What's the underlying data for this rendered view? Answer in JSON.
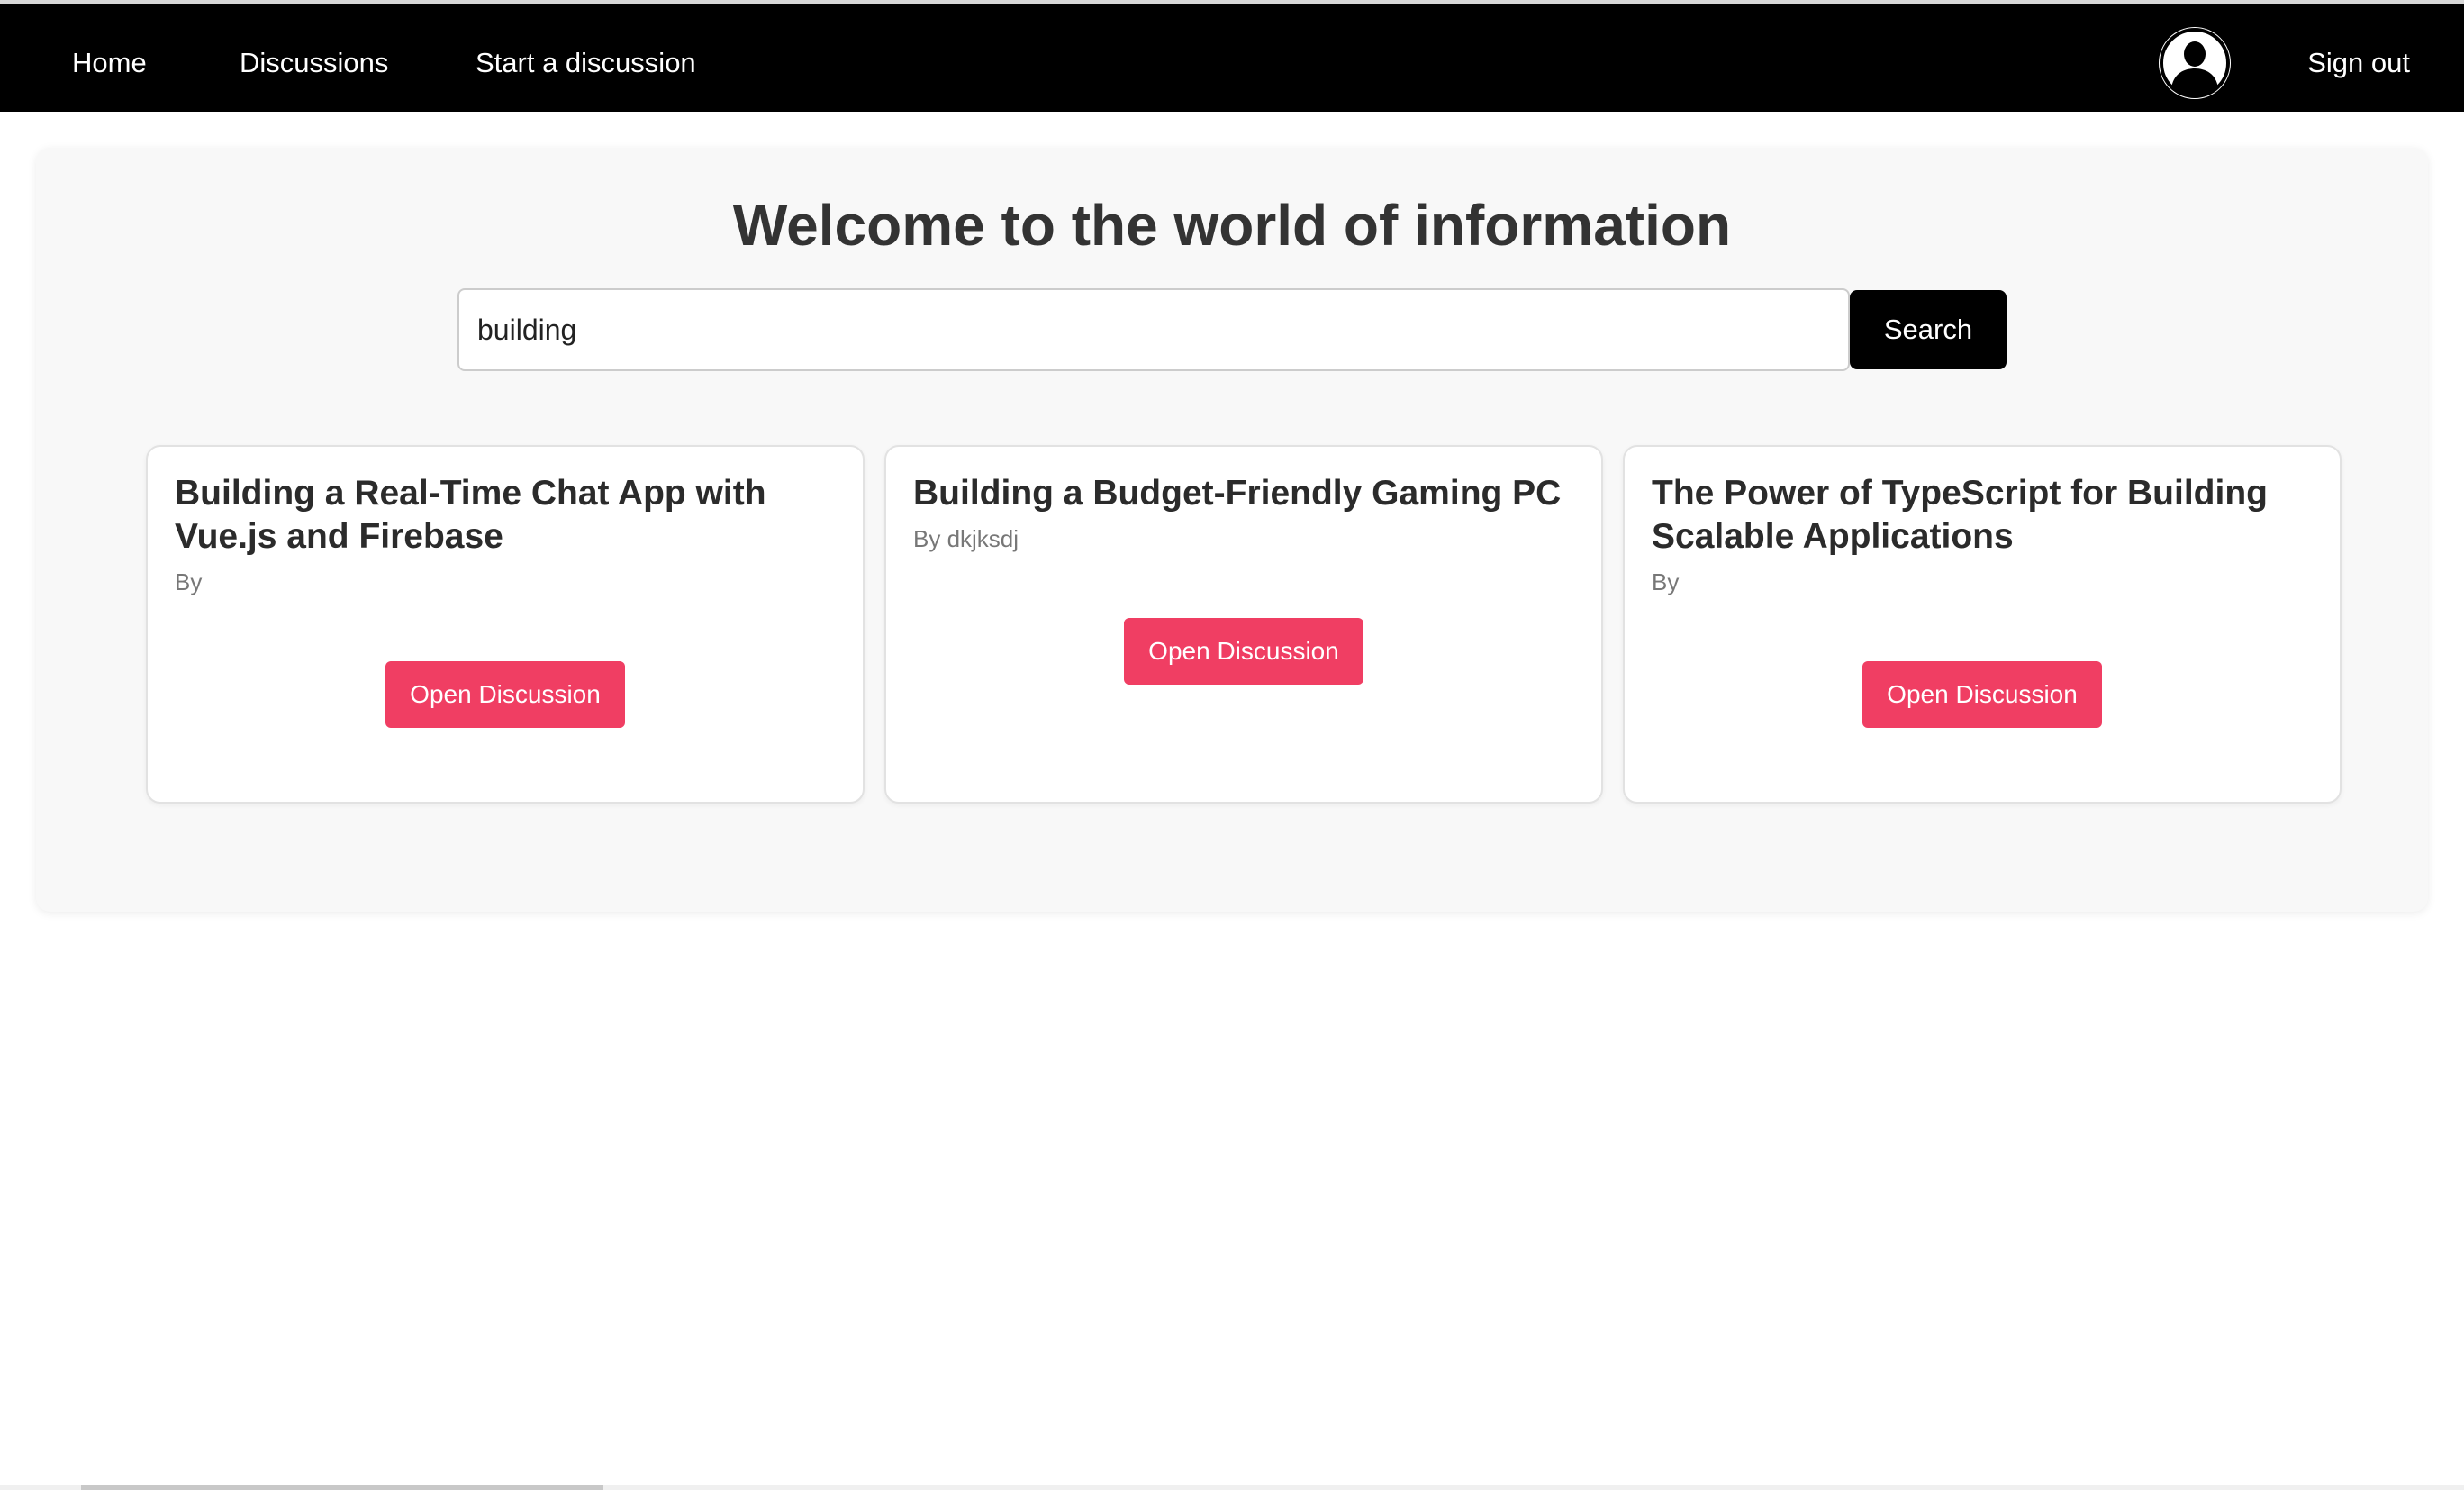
{
  "nav": {
    "home": "Home",
    "discussions": "Discussions",
    "start_discussion": "Start a discussion",
    "sign_out": "Sign out",
    "avatar_icon": "user-avatar-icon"
  },
  "main": {
    "title": "Welcome to the world of information",
    "search": {
      "value": "building",
      "button_label": "Search"
    },
    "results": [
      {
        "title": "Building a Real-Time Chat App with Vue.js and Firebase",
        "author": "By",
        "button_label": "Open Discussion"
      },
      {
        "title": "Building a Budget-Friendly Gaming PC",
        "author": "By dkjksdj",
        "button_label": "Open Discussion"
      },
      {
        "title": "The Power of TypeScript for Building Scalable Applications",
        "author": "By",
        "button_label": "Open Discussion"
      }
    ]
  },
  "colors": {
    "nav_background": "#000000",
    "accent_button": "#f03e63",
    "search_button": "#000000",
    "panel_background": "#f8f8f8"
  }
}
